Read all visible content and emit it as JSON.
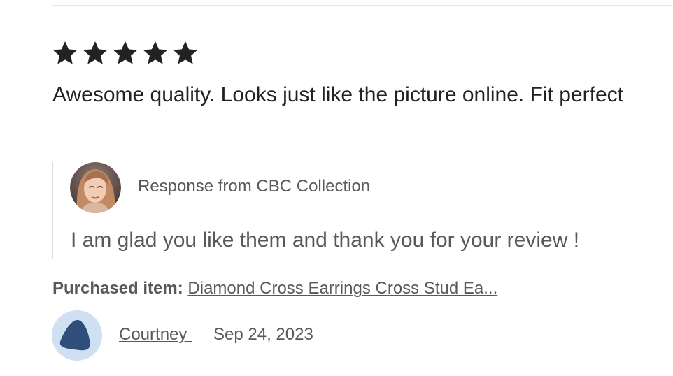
{
  "review": {
    "rating": 5,
    "rating_max": 5,
    "text": "Awesome quality. Looks just like the picture online. Fit perfect"
  },
  "response": {
    "label": "Response from CBC Collection",
    "text": "I am glad you like them and thank you for your review !"
  },
  "purchased": {
    "label": "Purchased item:",
    "item_name": "Diamond Cross Earrings Cross Stud Ea..."
  },
  "reviewer": {
    "name": "Courtney ",
    "date": "Sep 24, 2023"
  },
  "colors": {
    "star": "#222222",
    "text_primary": "#222222",
    "text_secondary": "#595959",
    "divider": "#e6e6e6",
    "avatar_bg": "#cfe0f3",
    "avatar_shape": "#2f4f7a"
  },
  "icons": {
    "star": "star-icon",
    "seller_avatar": "seller-avatar",
    "user_avatar": "default-user-avatar"
  }
}
